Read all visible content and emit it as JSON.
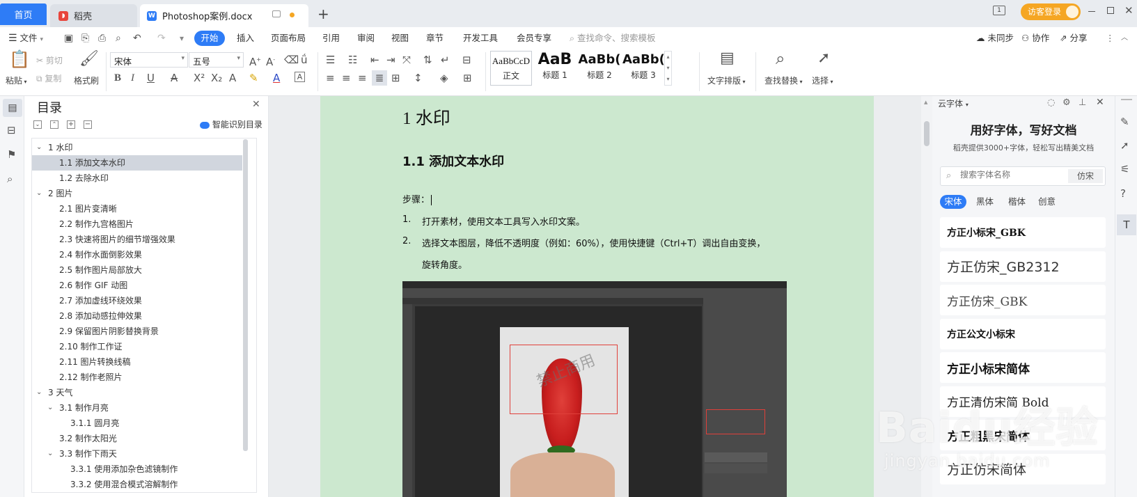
{
  "tabs": {
    "home": "首页",
    "daoke": "稻壳",
    "doc": "Photoshop案例.docx",
    "new_tab": "+"
  },
  "titlebar": {
    "login": "访客登录",
    "badge": "1"
  },
  "menu": {
    "file": "文件",
    "items": [
      "开始",
      "插入",
      "页面布局",
      "引用",
      "审阅",
      "视图",
      "章节",
      "开发工具",
      "会员专享"
    ],
    "search_placeholder": "查找命令、搜索模板",
    "sync": "未同步",
    "collab": "协作",
    "share": "分享"
  },
  "ribbon": {
    "paste": "粘贴",
    "cut": "剪切",
    "copy": "复制",
    "format_painter": "格式刷",
    "font_name": "宋体",
    "font_size": "五号",
    "styles": [
      {
        "preview": "AaBbCcD",
        "label": "正文"
      },
      {
        "preview": "AaB",
        "label": "标题 1"
      },
      {
        "preview": "AaBb(",
        "label": "标题 2"
      },
      {
        "preview": "AaBb(",
        "label": "标题 3"
      }
    ],
    "text_layout": "文字排版",
    "find_replace": "查找替换",
    "select": "选择"
  },
  "toc": {
    "title": "目录",
    "smart": "智能识别目录",
    "items": [
      {
        "text": "1 水印",
        "level": 1,
        "expander": true
      },
      {
        "text": "1.1 添加文本水印",
        "level": 2,
        "selected": true
      },
      {
        "text": "1.2 去除水印",
        "level": 2
      },
      {
        "text": "2 图片",
        "level": 1,
        "expander": true
      },
      {
        "text": "2.1 图片变清晰",
        "level": 2
      },
      {
        "text": "2.2 制作九宫格图片",
        "level": 2
      },
      {
        "text": "2.3 快速将图片的细节增强效果",
        "level": 2
      },
      {
        "text": "2.4 制作水面倒影效果",
        "level": 2
      },
      {
        "text": "2.5 制作图片局部放大",
        "level": 2
      },
      {
        "text": "2.6 制作 GIF 动图",
        "level": 2
      },
      {
        "text": "2.7 添加虚线环绕效果",
        "level": 2
      },
      {
        "text": "2.8 添加动感拉伸效果",
        "level": 2
      },
      {
        "text": "2.9 保留图片阴影替换背景",
        "level": 2
      },
      {
        "text": "2.10 制作工作证",
        "level": 2
      },
      {
        "text": "2.11 图片转换线稿",
        "level": 2
      },
      {
        "text": "2.12 制作老照片",
        "level": 2
      },
      {
        "text": "3 天气",
        "level": 1,
        "expander": true
      },
      {
        "text": "3.1 制作月亮",
        "level": 2,
        "expander": true
      },
      {
        "text": "3.1.1 圆月亮",
        "level": 3
      },
      {
        "text": "3.2 制作太阳光",
        "level": 2
      },
      {
        "text": "3.3 制作下雨天",
        "level": 2,
        "expander": true
      },
      {
        "text": "3.3.1 使用添加杂色滤镜制作",
        "level": 3
      },
      {
        "text": "3.3.2 使用混合模式溶解制作",
        "level": 3
      }
    ]
  },
  "document": {
    "h1": "1 水印",
    "h2": "1.1 添加文本水印",
    "steps_label": "步骤：",
    "step1_num": "1.",
    "step1": "打开素材，使用文本工具写入水印文案。",
    "step2_num": "2.",
    "step2": "选择文本图层，降低不透明度（例如：60%），使用快捷键（Ctrl+T）调出自由变换，",
    "step2_cont": "旋转角度。",
    "watermark_text": "禁止商用"
  },
  "fontpanel": {
    "title": "云字体",
    "headline": "用好字体，写好文档",
    "subline": "稻壳提供3000+字体，轻松写出精美文档",
    "search_placeholder": "搜索字体名称",
    "search_tag": "仿宋",
    "categories": [
      "宋体",
      "黑体",
      "楷体",
      "创意"
    ],
    "fonts": [
      "方正小标宋_GBK",
      "方正仿宋_GB2312",
      "方正仿宋_GBK",
      "方正公文小标宋",
      "方正小标宋简体",
      "方正清仿宋简 Bold",
      "方正粗黑宋简体",
      "方正仿宋简体"
    ]
  },
  "watermark": {
    "brand": "Baidu经验",
    "url": "jingyan.baidu.com"
  },
  "colors": {
    "accent": "#2e7cf6",
    "page_bg": "#cce8cf",
    "login_btn": "#f5a623"
  }
}
